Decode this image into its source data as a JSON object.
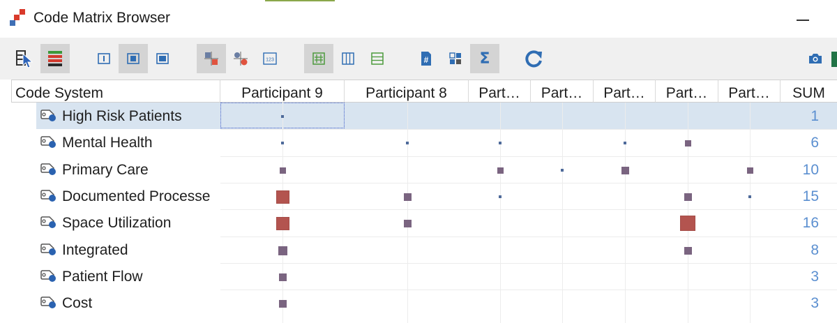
{
  "window": {
    "title": "Code Matrix Browser"
  },
  "colors": {
    "small_mark": "#4e6a9a",
    "medium_mark": "#7a6480",
    "large_mark": "#b3544f",
    "sum_text": "#5b8fd0",
    "selection": "#d8e4f0"
  },
  "toolbar": {
    "buttons": [
      {
        "name": "select-cursor-icon",
        "active": false
      },
      {
        "name": "color-bars-icon",
        "active": true
      },
      {
        "name": "layout-left-icon",
        "active": false
      },
      {
        "name": "layout-center-icon",
        "active": true
      },
      {
        "name": "layout-full-icon",
        "active": false
      },
      {
        "name": "squares-visualization-icon",
        "active": true
      },
      {
        "name": "circles-visualization-icon",
        "active": false
      },
      {
        "name": "numbers-visualization-icon",
        "active": false
      },
      {
        "name": "grid-view-icon",
        "active": true
      },
      {
        "name": "columns-view-icon",
        "active": false
      },
      {
        "name": "rows-view-icon",
        "active": false
      },
      {
        "name": "hash-icon",
        "active": false
      },
      {
        "name": "binary-icon",
        "active": false
      },
      {
        "name": "sigma-icon",
        "active": true
      },
      {
        "name": "refresh-icon",
        "active": false
      },
      {
        "name": "camera-icon",
        "active": false
      }
    ],
    "numbers_button_label": "123",
    "sigma_label": "Σ",
    "hash_label": "#"
  },
  "header": {
    "code_system": "Code System",
    "columns": [
      "Participant 9",
      "Participant 8",
      "Part…",
      "Part…",
      "Part…",
      "Part…",
      "Part…"
    ],
    "sum": "SUM"
  },
  "rows": [
    {
      "label": "High Risk Patients",
      "sum": "1",
      "selected": true,
      "cells": [
        1,
        0,
        0,
        0,
        0,
        0,
        0
      ]
    },
    {
      "label": "Mental Health",
      "sum": "6",
      "cells": [
        1,
        1,
        1,
        0,
        1,
        2,
        0
      ]
    },
    {
      "label": "Primary Care",
      "sum": "10",
      "cells": [
        2,
        0,
        2,
        1,
        3,
        0,
        2
      ]
    },
    {
      "label": "Documented Processe",
      "sum": "15",
      "cells": [
        5,
        3,
        1,
        0,
        0,
        3,
        1
      ]
    },
    {
      "label": "Space Utilization",
      "sum": "16",
      "cells": [
        5,
        3,
        0,
        0,
        0,
        6,
        0
      ]
    },
    {
      "label": "Integrated",
      "sum": "8",
      "cells": [
        4,
        0,
        0,
        0,
        0,
        3,
        0
      ]
    },
    {
      "label": "Patient Flow",
      "sum": "3",
      "cells": [
        3,
        0,
        0,
        0,
        0,
        0,
        0
      ]
    },
    {
      "label": "Cost",
      "sum": "3",
      "cells": [
        3,
        0,
        0,
        0,
        0,
        0,
        0
      ]
    }
  ]
}
